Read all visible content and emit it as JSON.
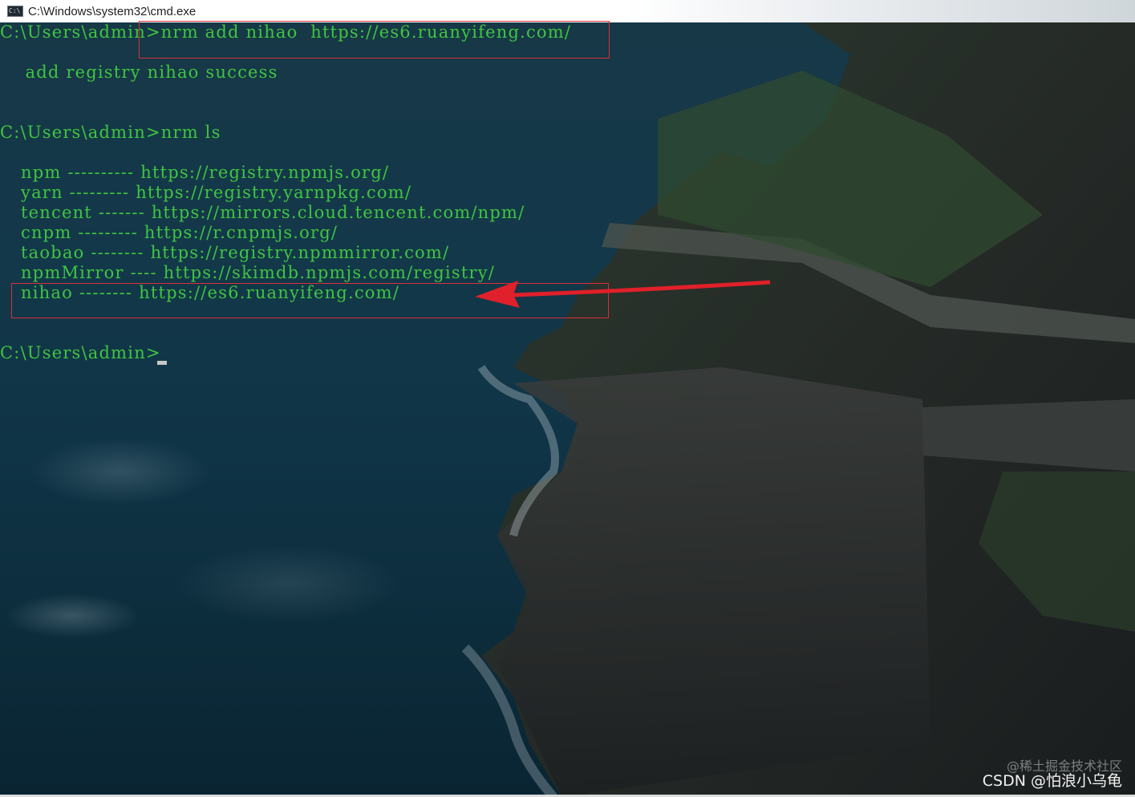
{
  "window": {
    "title": "C:\\Windows\\system32\\cmd.exe",
    "icon": "cmd-icon"
  },
  "terminal": {
    "prompt1": "C:\\Users\\admin>",
    "command1": "nrm add nihao  https://es6.ruanyifeng.com/",
    "output1": "    add registry nihao success",
    "prompt2": "C:\\Users\\admin>",
    "command2": "nrm ls",
    "registries": [
      {
        "name": "npm",
        "dashes": "----------",
        "url": "https://registry.npmjs.org/"
      },
      {
        "name": "yarn",
        "dashes": "---------",
        "url": "https://registry.yarnpkg.com/"
      },
      {
        "name": "tencent",
        "dashes": "-------",
        "url": "https://mirrors.cloud.tencent.com/npm/"
      },
      {
        "name": "cnpm",
        "dashes": "---------",
        "url": "https://r.cnpmjs.org/"
      },
      {
        "name": "taobao",
        "dashes": "--------",
        "url": "https://registry.npmmirror.com/"
      },
      {
        "name": "npmMirror",
        "dashes": "----",
        "url": "https://skimdb.npmjs.com/registry/"
      },
      {
        "name": "nihao",
        "dashes": "--------",
        "url": "https://es6.ruanyifeng.com/"
      }
    ],
    "prompt3": "C:\\Users\\admin>",
    "text_color": "#3fc63f"
  },
  "annotations": {
    "box_color": "#d8303a",
    "arrow_color": "#e0202a"
  },
  "watermark": {
    "line1": "@稀土掘金技术社区",
    "line2": "CSDN @怕浪小乌龟"
  }
}
